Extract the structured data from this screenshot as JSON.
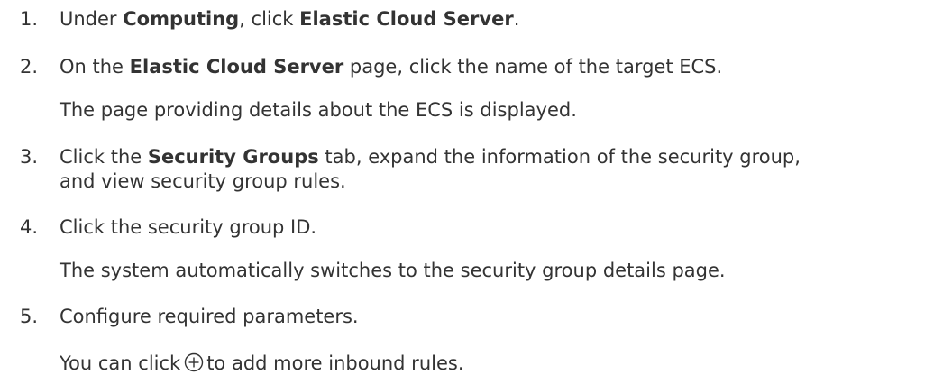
{
  "steps": [
    {
      "number": "1.",
      "parts": [
        "Under ",
        "Computing",
        ", click ",
        "Elastic Cloud Server",
        "."
      ]
    },
    {
      "number": "2.",
      "parts": [
        "On the ",
        "Elastic Cloud Server",
        " page, click the name of the target ECS."
      ],
      "result": "The page providing details about the ECS is displayed."
    },
    {
      "number": "3.",
      "parts": [
        "Click the ",
        "Security Groups",
        " tab, expand the information of the security group,"
      ],
      "continuation": "and view security group rules."
    },
    {
      "number": "4.",
      "text": "Click the security group ID.",
      "result": "The system automatically switches to the security group details page."
    },
    {
      "number": "5.",
      "text": "Configure required parameters.",
      "note_before": "You can click",
      "note_icon": "add-circle-icon",
      "note_after": "to add more inbound rules."
    }
  ]
}
